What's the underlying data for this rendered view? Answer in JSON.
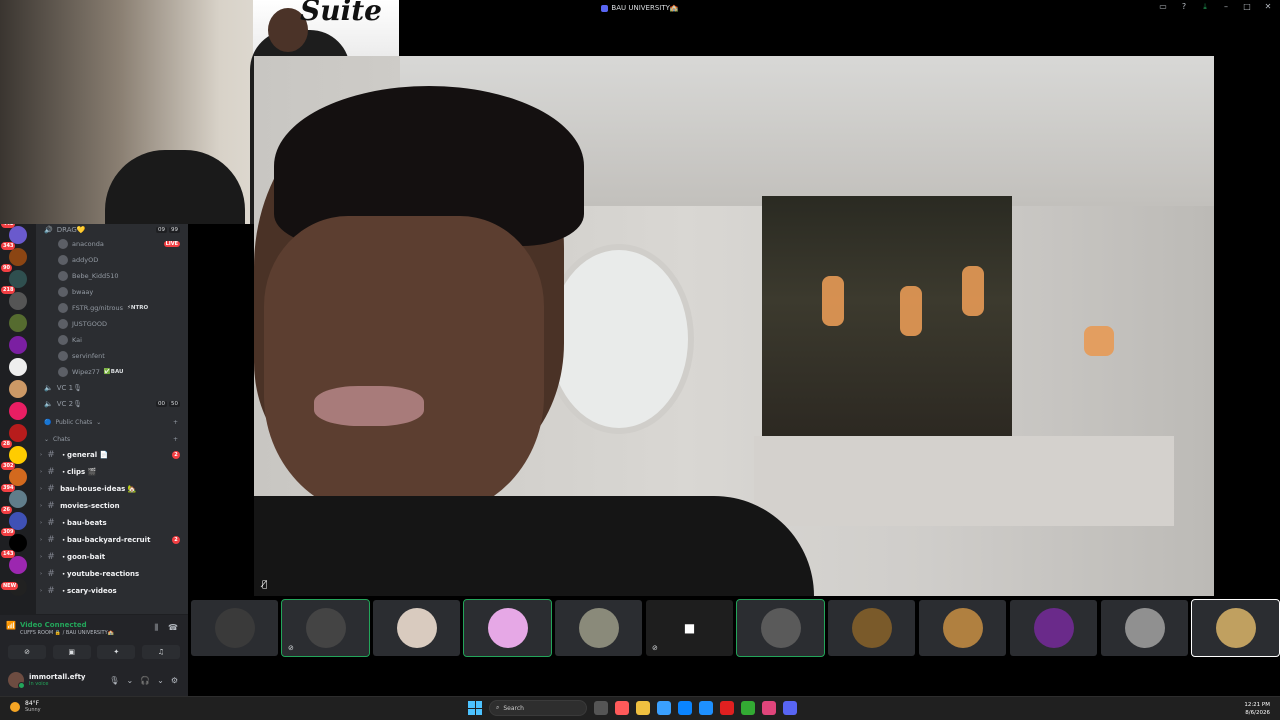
{
  "window": {
    "title": "BAU UNIVERSITY🏫"
  },
  "rail": {
    "servers": [
      {
        "badge": "442",
        "color": "#6a5acd"
      },
      {
        "badge": "343",
        "color": "#8b4513"
      },
      {
        "badge": "90",
        "color": "#2f4f4f"
      },
      {
        "badge": "218",
        "color": "#555555"
      },
      {
        "badge": "",
        "color": "#556b2f"
      },
      {
        "badge": "",
        "color": "#7b1fa2"
      },
      {
        "badge": "",
        "color": "#eeeeee"
      },
      {
        "badge": "",
        "color": "#cc9966"
      },
      {
        "badge": "",
        "color": "#e91e63"
      },
      {
        "badge": "",
        "color": "#b71c1c"
      },
      {
        "badge": "28",
        "color": "#ffcc00"
      },
      {
        "badge": "302",
        "color": "#d2691e"
      },
      {
        "badge": "394",
        "color": "#607d8b"
      },
      {
        "badge": "26",
        "color": "#3f51b5"
      },
      {
        "badge": "309",
        "color": "#000000"
      },
      {
        "badge": "143",
        "color": "#9c27b0"
      },
      {
        "badge": "NEW",
        "color": "#212121"
      }
    ]
  },
  "channels": {
    "voice_channel": {
      "name": "DRAG💛",
      "count_a": "09",
      "count_b": "99"
    },
    "members": [
      {
        "name": "anaconda",
        "badge": "LIVE"
      },
      {
        "name": "addyOD",
        "badge": ""
      },
      {
        "name": "Bebe_Kidd510",
        "badge": ""
      },
      {
        "name": "bwaay",
        "badge": ""
      },
      {
        "name": "FSTR.gg/nitrous",
        "badge": "⚡NTRO"
      },
      {
        "name": "JUSTGOOD",
        "badge": ""
      },
      {
        "name": "Kai",
        "badge": ""
      },
      {
        "name": "servinfent",
        "badge": ""
      },
      {
        "name": "Wipez77",
        "badge": "✅BAU"
      }
    ],
    "vc1": {
      "name": "VC 1🎙"
    },
    "vc2": {
      "name": "VC 2🎙",
      "count_a": "00",
      "count_b": "50"
    },
    "category_public": "Public Chats",
    "category_chats": "Chats",
    "text_channels": [
      {
        "name": "・general 📄",
        "mention": "2"
      },
      {
        "name": "・clips 🎬",
        "mention": ""
      },
      {
        "name": "bau-house-ideas 🏡",
        "mention": ""
      },
      {
        "name": "movies-section",
        "mention": ""
      },
      {
        "name": "・bau-beats",
        "mention": ""
      },
      {
        "name": "・bau-backyard-recruit",
        "mention": "2"
      },
      {
        "name": "・goon-bait",
        "mention": ""
      },
      {
        "name": "・youtube-reactions",
        "mention": ""
      },
      {
        "name": "・scary-videos",
        "mention": ""
      }
    ]
  },
  "voice_panel": {
    "status": "Video Connected",
    "location": "CUFFS ROOM 🔒 / BAU UNIVERSITY🏫"
  },
  "user": {
    "name": "immortall.efty",
    "status": "In voice"
  },
  "stream": {
    "preview_sign": "Suite"
  },
  "tiles": [
    {
      "kind": "face",
      "color": "#3a3a3a",
      "state": ""
    },
    {
      "kind": "face",
      "color": "#444444",
      "state": "speaking",
      "muted": true
    },
    {
      "kind": "face",
      "color": "#d9cbbf",
      "state": ""
    },
    {
      "kind": "face",
      "color": "#e6a8e6",
      "state": "speaking"
    },
    {
      "kind": "face",
      "color": "#8a8a7a",
      "state": ""
    },
    {
      "kind": "cam-off",
      "color": "#1e1e1e",
      "state": "",
      "muted": true
    },
    {
      "kind": "face",
      "color": "#5a5a5a",
      "state": "speaking"
    },
    {
      "kind": "face",
      "color": "#7a5a2a",
      "state": ""
    },
    {
      "kind": "face",
      "color": "#b08040",
      "state": ""
    },
    {
      "kind": "face",
      "color": "#6a2a8a",
      "state": ""
    },
    {
      "kind": "face",
      "color": "#909090",
      "state": ""
    },
    {
      "kind": "face",
      "color": "#c0a060",
      "state": "selected"
    }
  ],
  "taskbar": {
    "temp": "84°F",
    "condition": "Sunny",
    "search_placeholder": "Search",
    "time": "12:21 PM",
    "date": "8/6/2026",
    "apps": [
      "#555555",
      "#ff5a5a",
      "#f0c040",
      "#3aa0ff",
      "#0a84ff",
      "#1e90ff",
      "#e02020",
      "#33aa33",
      "#e0457b",
      "#5865f2"
    ]
  }
}
